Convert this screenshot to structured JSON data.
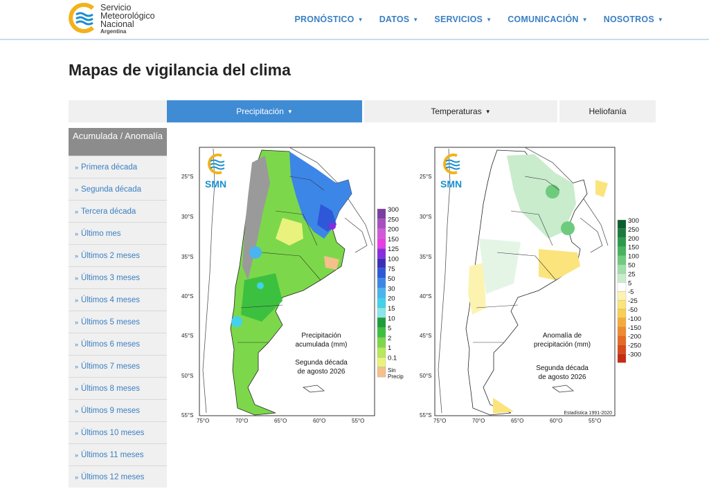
{
  "header": {
    "org_line1": "Servicio",
    "org_line2": "Meteorológico",
    "org_line3": "Nacional",
    "org_country": "Argentina",
    "nav": [
      {
        "label": "PRONÓSTICO"
      },
      {
        "label": "DATOS"
      },
      {
        "label": "SERVICIOS"
      },
      {
        "label": "COMUNICACIÓN"
      },
      {
        "label": "NOSOTROS"
      }
    ]
  },
  "page_title": "Mapas de vigilancia del clima",
  "tabs": {
    "precip": "Precipitación",
    "temp": "Temperaturas",
    "helio": "Heliofanía",
    "active": "precip"
  },
  "sidebar": {
    "header": "Acumulada / Anomalía",
    "items": [
      {
        "label": "Primera década"
      },
      {
        "label": "Segunda década"
      },
      {
        "label": "Tercera década"
      },
      {
        "label": "Último mes"
      },
      {
        "label": "Últimos 2 meses"
      },
      {
        "label": "Últimos 3 meses"
      },
      {
        "label": "Últimos 4 meses"
      },
      {
        "label": "Últimos 5 meses"
      },
      {
        "label": "Últimos 6 meses"
      },
      {
        "label": "Últimos 7 meses"
      },
      {
        "label": "Últimos 8 meses"
      },
      {
        "label": "Últimos 9 meses"
      },
      {
        "label": "Últimos 10 meses"
      },
      {
        "label": "Últimos 11 meses"
      },
      {
        "label": "Últimos 12 meses"
      }
    ]
  },
  "map_common": {
    "logo": "SMN",
    "lat_ticks": [
      "25°S",
      "30°S",
      "35°S",
      "40°S",
      "45°S",
      "50°S",
      "55°S"
    ],
    "lon_ticks": [
      "75°O",
      "70°O",
      "65°O",
      "60°O",
      "55°O"
    ]
  },
  "map_precip": {
    "title1": "Precipitación",
    "title2": "acumulada (mm)",
    "period1": "Segunda década",
    "period2": "de agosto 2026",
    "legend": [
      {
        "label": "300",
        "color": "#7b3fa0"
      },
      {
        "label": "250",
        "color": "#a84ec0"
      },
      {
        "label": "200",
        "color": "#d25ad8"
      },
      {
        "label": "150",
        "color": "#e83ee3"
      },
      {
        "label": "125",
        "color": "#8a2be2"
      },
      {
        "label": "100",
        "color": "#3a2fb8"
      },
      {
        "label": "75",
        "color": "#2e58d8"
      },
      {
        "label": "50",
        "color": "#3c86e8"
      },
      {
        "label": "30",
        "color": "#4ab4f0"
      },
      {
        "label": "20",
        "color": "#42d2ec"
      },
      {
        "label": "15",
        "color": "#8ae6ea"
      },
      {
        "label": "10",
        "color": "#1e9e3a"
      },
      {
        "label": "5",
        "color": "#3cc040"
      },
      {
        "label": "2",
        "color": "#7cd84a"
      },
      {
        "label": "1",
        "color": "#b8e85c"
      },
      {
        "label": "0.1",
        "color": "#eaf27e"
      },
      {
        "label": "Sin Precip",
        "color": "#f5c08a"
      }
    ]
  },
  "map_anom": {
    "title1": "Anomalía de",
    "title2": "precipitación (mm)",
    "period1": "Segunda década",
    "period2": "de agosto 2026",
    "stat": "Estadística 1991-2020",
    "legend": [
      {
        "label": "300",
        "color": "#0b5e2e"
      },
      {
        "label": "250",
        "color": "#1a7c3c"
      },
      {
        "label": "200",
        "color": "#2c9a4c"
      },
      {
        "label": "150",
        "color": "#45b45e"
      },
      {
        "label": "100",
        "color": "#6ecb7e"
      },
      {
        "label": "50",
        "color": "#9fdfa8"
      },
      {
        "label": "25",
        "color": "#c9eccc"
      },
      {
        "label": "5",
        "color": "#ffffff"
      },
      {
        "label": "-5",
        "color": "#fdf3b0"
      },
      {
        "label": "-25",
        "color": "#fbe47c"
      },
      {
        "label": "-50",
        "color": "#f8cf52"
      },
      {
        "label": "-100",
        "color": "#f5ab3c"
      },
      {
        "label": "-150",
        "color": "#f08a2e"
      },
      {
        "label": "-200",
        "color": "#e66a22"
      },
      {
        "label": "-250",
        "color": "#d84a1a"
      },
      {
        "label": "-300",
        "color": "#c62c12"
      }
    ]
  }
}
